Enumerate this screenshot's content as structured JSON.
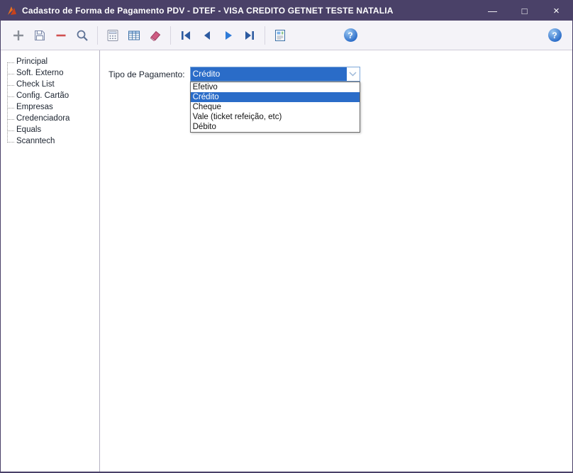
{
  "window": {
    "title": "Cadastro de Forma de Pagamento PDV - DTEF - VISA CREDITO GETNET TESTE NATALIA",
    "controls": {
      "minimize": "—",
      "maximize": "□",
      "close": "×"
    }
  },
  "toolbar": {
    "icons": [
      "add",
      "save",
      "remove",
      "search",
      "calculator",
      "table-grid",
      "eraser",
      "nav-first",
      "nav-prev",
      "nav-next",
      "nav-last",
      "report-preview",
      "help",
      "help"
    ],
    "help_glyph": "?"
  },
  "sidebar": {
    "items": [
      "Principal",
      "Soft. Externo",
      "Check List",
      "Config. Cartão",
      "Empresas",
      "Credenciadora",
      "Equals",
      "Scanntech"
    ]
  },
  "main": {
    "payment_type_label": "Tipo de Pagamento:",
    "combobox": {
      "value": "Crédito",
      "selected_index": 1,
      "options": [
        "Efetivo",
        "Crédito",
        "Cheque",
        "Vale (ticket refeição, etc)",
        "Débito"
      ]
    }
  },
  "colors": {
    "titlebar": "#4a4168",
    "window_border": "#4a4168",
    "toolbar_bg": "#f4f3f8",
    "selection": "#2a6cc8"
  }
}
